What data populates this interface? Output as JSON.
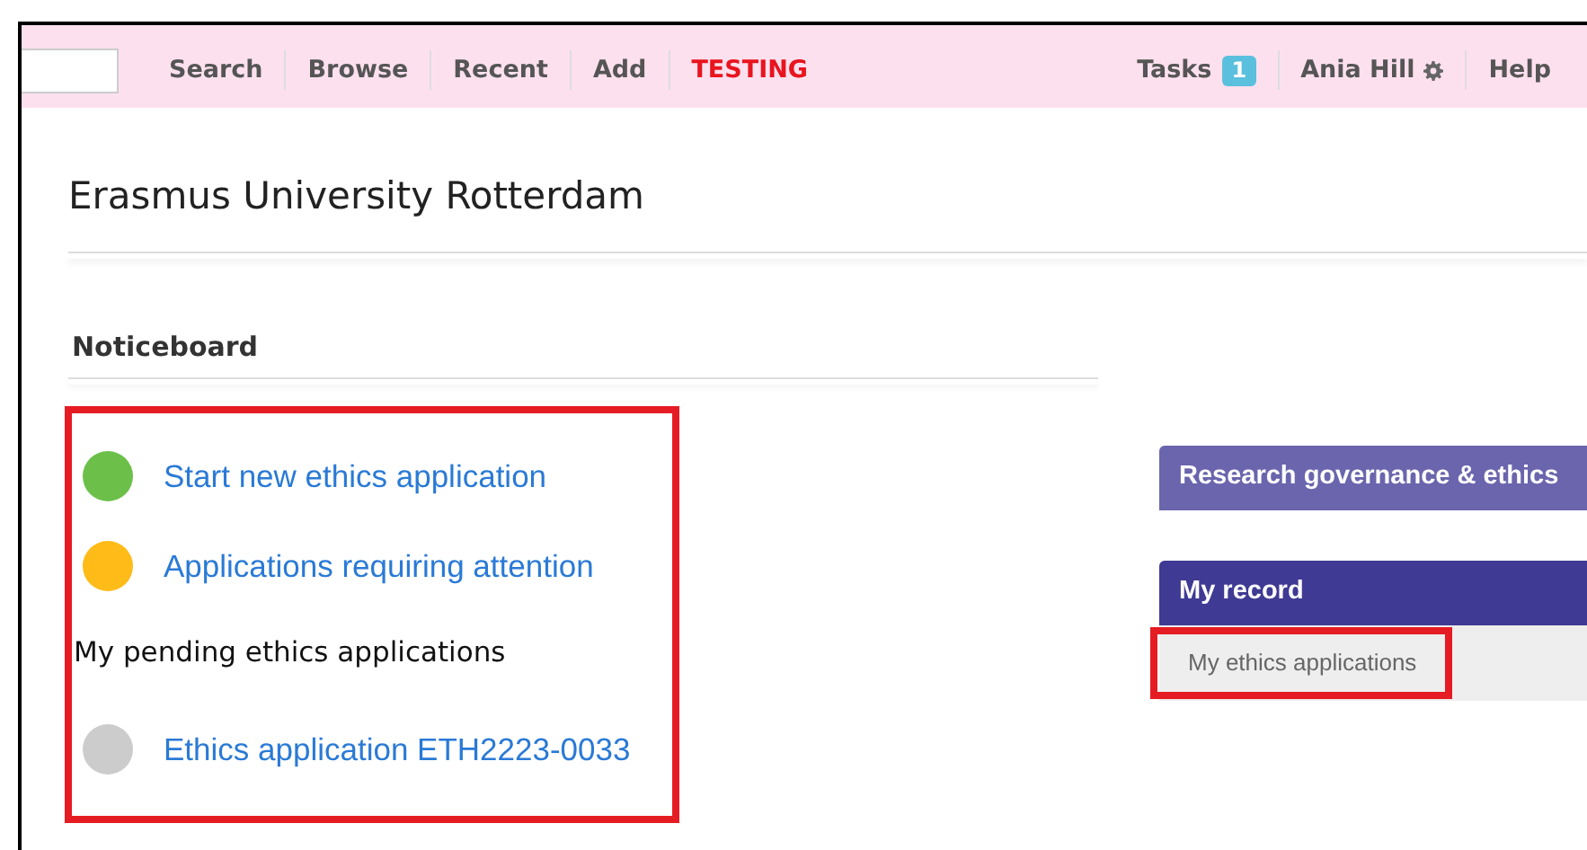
{
  "navbar": {
    "search_field": true,
    "items": [
      {
        "label": "Search",
        "kind": "link"
      },
      {
        "label": "Browse",
        "kind": "link"
      },
      {
        "label": "Recent",
        "kind": "link"
      },
      {
        "label": "Add",
        "kind": "link"
      },
      {
        "label": "TESTING",
        "kind": "alert"
      }
    ],
    "right_items": [
      {
        "label": "Tasks",
        "badge": "1",
        "kind": "badge"
      },
      {
        "label": "Ania Hill",
        "kind": "gear"
      },
      {
        "label": "Help",
        "kind": "link"
      }
    ]
  },
  "page_title": "Erasmus University Rotterdam",
  "noticeboard": {
    "title": "Noticeboard",
    "highlighted": true,
    "entries": [
      {
        "kind": "link",
        "label": "Start new ethics application",
        "color": "#6cc04a"
      },
      {
        "kind": "link",
        "label": "Applications requiring attention",
        "color": "#ffbb17"
      },
      {
        "kind": "heading",
        "label": "My pending ethics applications"
      },
      {
        "kind": "link",
        "label": "Ethics application ETH2223-0033",
        "color": "#cccccc"
      }
    ]
  },
  "sidebar": [
    {
      "kind": "header",
      "label": "Research governance & ethics",
      "color": "#6a65ad"
    },
    {
      "kind": "header",
      "label": "My record",
      "color": "#3f3a93",
      "items": [
        {
          "label": "My ethics applications",
          "highlighted": true
        }
      ]
    }
  ]
}
